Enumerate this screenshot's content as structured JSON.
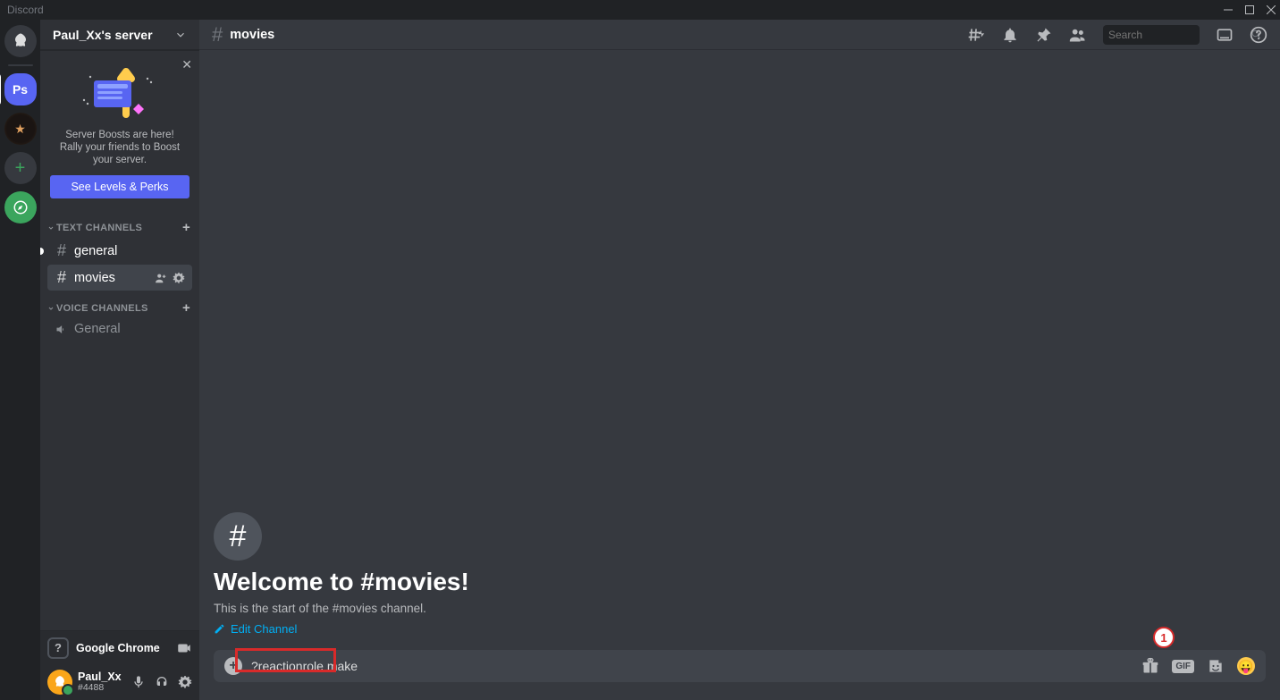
{
  "app_name": "Discord",
  "titlebar": {
    "label": "Discord"
  },
  "servers": {
    "ps_label": "Ps",
    "aa_label": "★"
  },
  "server_header": {
    "name": "Paul_Xx's server"
  },
  "boost": {
    "text": "Server Boosts are here! Rally your friends to Boost your server.",
    "button": "See Levels & Perks"
  },
  "categories": {
    "text": {
      "label": "TEXT CHANNELS"
    },
    "voice": {
      "label": "VOICE CHANNELS"
    }
  },
  "channels": {
    "general": "general",
    "movies": "movies",
    "voice_general": "General"
  },
  "activity": {
    "label": "Google Chrome",
    "icon_char": "?"
  },
  "user": {
    "name": "Paul_Xx",
    "discrim": "#4488"
  },
  "header": {
    "channel": "movies",
    "search_placeholder": "Search"
  },
  "welcome": {
    "title": "Welcome to #movies!",
    "subtitle": "This is the start of the #movies channel.",
    "edit": "Edit Channel"
  },
  "composer": {
    "value": "?reactionrole make",
    "gif": "GIF"
  },
  "annotation": {
    "badge": "1"
  }
}
